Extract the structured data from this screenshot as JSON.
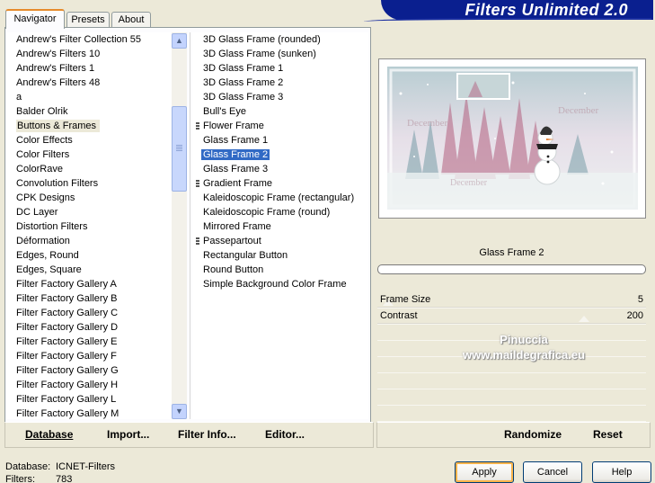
{
  "tabs": [
    {
      "label": "Navigator",
      "active": true
    },
    {
      "label": "Presets",
      "active": false
    },
    {
      "label": "About",
      "active": false
    }
  ],
  "banner": {
    "title": "Filters Unlimited 2.0",
    "color": "#0a1f8f"
  },
  "categories": {
    "items": [
      "Andrew's Filter Collection 55",
      "Andrew's Filters 10",
      "Andrew's Filters 1",
      "Andrew's Filters 48",
      "a",
      "Balder Olrik",
      "Buttons & Frames",
      "Color Effects",
      "Color Filters",
      "ColorRave",
      "Convolution Filters",
      "CPK Designs",
      "DC Layer",
      "Distortion Filters",
      "Déformation",
      "Edges, Round",
      "Edges, Square",
      "Filter Factory Gallery A",
      "Filter Factory Gallery B",
      "Filter Factory Gallery C",
      "Filter Factory Gallery D",
      "Filter Factory Gallery E",
      "Filter Factory Gallery F",
      "Filter Factory Gallery G",
      "Filter Factory Gallery H",
      "Filter Factory Gallery L",
      "Filter Factory Gallery M"
    ],
    "selected": "Buttons & Frames"
  },
  "filters": {
    "items": [
      {
        "label": "3D Glass Frame (rounded)",
        "grip": false
      },
      {
        "label": "3D Glass Frame (sunken)",
        "grip": false
      },
      {
        "label": "3D Glass Frame 1",
        "grip": false
      },
      {
        "label": "3D Glass Frame 2",
        "grip": false
      },
      {
        "label": "3D Glass Frame 3",
        "grip": false
      },
      {
        "label": "Bull's Eye",
        "grip": false
      },
      {
        "label": "Flower Frame",
        "grip": true
      },
      {
        "label": "Glass Frame 1",
        "grip": false
      },
      {
        "label": "Glass Frame 2",
        "grip": false
      },
      {
        "label": "Glass Frame 3",
        "grip": false
      },
      {
        "label": "Gradient Frame",
        "grip": true
      },
      {
        "label": "Kaleidoscopic Frame (rectangular)",
        "grip": false
      },
      {
        "label": "Kaleidoscopic Frame (round)",
        "grip": false
      },
      {
        "label": "Mirrored Frame",
        "grip": false
      },
      {
        "label": "Passepartout",
        "grip": true
      },
      {
        "label": "Rectangular Button",
        "grip": false
      },
      {
        "label": "Round Button",
        "grip": false
      },
      {
        "label": "Simple Background Color Frame",
        "grip": false
      }
    ],
    "selected": "Glass Frame 2",
    "selection_color": "#316ac5"
  },
  "left_buttons": {
    "database": "Database",
    "import": "Import...",
    "filter_info": "Filter Info...",
    "editor": "Editor..."
  },
  "filter_panel": {
    "title": "Glass Frame 2",
    "params": [
      {
        "label": "Frame Size",
        "value": "5",
        "level": 0.02
      },
      {
        "label": "Contrast",
        "value": "200",
        "level": 0.78
      }
    ],
    "randomize": "Randomize",
    "reset": "Reset"
  },
  "preview": {
    "texts": [
      "December",
      "December",
      "December"
    ]
  },
  "watermark": {
    "line1": "Pinuccia",
    "line2": "www.maildegrafica.eu"
  },
  "status": {
    "database_key": "Database:",
    "database_value": "ICNET-Filters",
    "filters_key": "Filters:",
    "filters_value": "783"
  },
  "dialog_buttons": {
    "apply": "Apply",
    "cancel": "Cancel",
    "help": "Help"
  }
}
